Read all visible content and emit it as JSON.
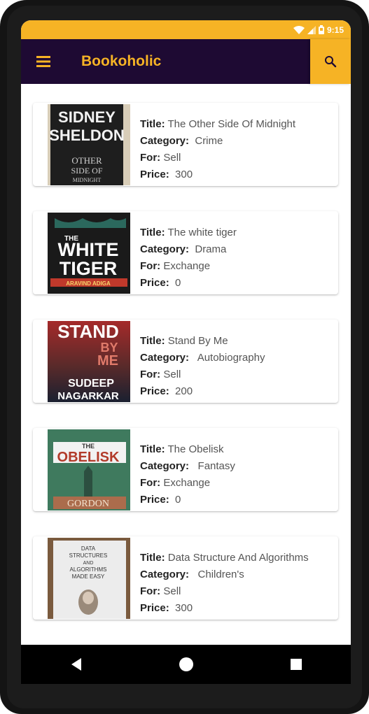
{
  "status_bar": {
    "time": "9:15",
    "color": "#f6b325"
  },
  "app_bar": {
    "title": "Bookoholic",
    "background": "#1e0a33",
    "accent": "#f6b325"
  },
  "labels": {
    "title": "Title:",
    "category": "Category:",
    "for": "For:",
    "price": "Price:"
  },
  "books": [
    {
      "title": "The Other Side Of Midnight",
      "category": "Crime",
      "for": "Sell",
      "price": "300",
      "cover_text": [
        "SIDNEY",
        "SHELDON",
        "OTHER",
        "SIDE OF",
        "MIDNIGHT"
      ]
    },
    {
      "title": "The white tiger",
      "category": "Drama",
      "for": "Exchange",
      "price": "0",
      "cover_text": [
        "THE",
        "WHITE",
        "TIGER",
        "ARAVIND ADIGA"
      ]
    },
    {
      "title": "Stand By Me",
      "category": "Autobiography",
      "for": "Sell",
      "price": "200",
      "cover_text": [
        "STAND",
        "BY",
        "ME",
        "SUDEEP",
        "NAGARKAR"
      ]
    },
    {
      "title": "The Obelisk",
      "category": "Fantasy",
      "for": "Exchange",
      "price": "0",
      "cover_text": [
        "THE",
        "OBELISK",
        "GORDON"
      ]
    },
    {
      "title": "Data Structure And Algorithms",
      "category": "Children's",
      "for": "Sell",
      "price": "300",
      "cover_text": [
        "DATA",
        "STRUCTURES",
        "AND",
        "ALGORITHMS",
        "MADE EASY"
      ]
    }
  ],
  "icons": {
    "menu": "menu-icon",
    "search": "search-icon",
    "back": "back-icon",
    "home": "home-icon",
    "recents": "recents-icon"
  }
}
